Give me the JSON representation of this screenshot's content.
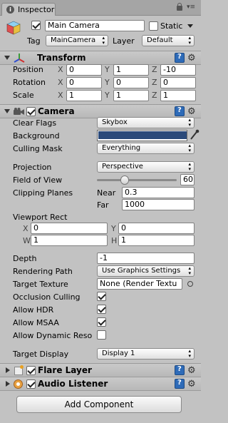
{
  "tab": {
    "label": "Inspector"
  },
  "gameobject": {
    "name": "Main Camera",
    "static_label": "Static",
    "tag_label": "Tag",
    "tag_value": "MainCamera",
    "layer_label": "Layer",
    "layer_value": "Default"
  },
  "transform": {
    "title": "Transform",
    "position_label": "Position",
    "rotation_label": "Rotation",
    "scale_label": "Scale",
    "x": "X",
    "y": "Y",
    "z": "Z",
    "position": {
      "x": "0",
      "y": "1",
      "z": "-10"
    },
    "rotation": {
      "x": "0",
      "y": "0",
      "z": "0"
    },
    "scale": {
      "x": "1",
      "y": "1",
      "z": "1"
    }
  },
  "camera": {
    "title": "Camera",
    "clear_flags_label": "Clear Flags",
    "clear_flags_value": "Skybox",
    "background_label": "Background",
    "background_color": "#2b4a7a",
    "culling_mask_label": "Culling Mask",
    "culling_mask_value": "Everything",
    "projection_label": "Projection",
    "projection_value": "Perspective",
    "fov_label": "Field of View",
    "fov_value": "60",
    "fov_fraction": 0.33,
    "clipping_label": "Clipping Planes",
    "near_label": "Near",
    "near_value": "0.3",
    "far_label": "Far",
    "far_value": "1000",
    "viewport_label": "Viewport Rect",
    "vp_x_label": "X",
    "vp_x": "0",
    "vp_y_label": "Y",
    "vp_y": "0",
    "vp_w_label": "W",
    "vp_w": "1",
    "vp_h_label": "H",
    "vp_h": "1",
    "depth_label": "Depth",
    "depth_value": "-1",
    "rendering_path_label": "Rendering Path",
    "rendering_path_value": "Use Graphics Settings",
    "target_texture_label": "Target Texture",
    "target_texture_value": "None (Render Textu",
    "occlusion_label": "Occlusion Culling",
    "hdr_label": "Allow HDR",
    "msaa_label": "Allow MSAA",
    "dyn_res_label": "Allow Dynamic Reso",
    "target_display_label": "Target Display",
    "target_display_value": "Display 1"
  },
  "flare": {
    "title": "Flare Layer"
  },
  "audio": {
    "title": "Audio Listener"
  },
  "add_component": {
    "label": "Add Component"
  }
}
